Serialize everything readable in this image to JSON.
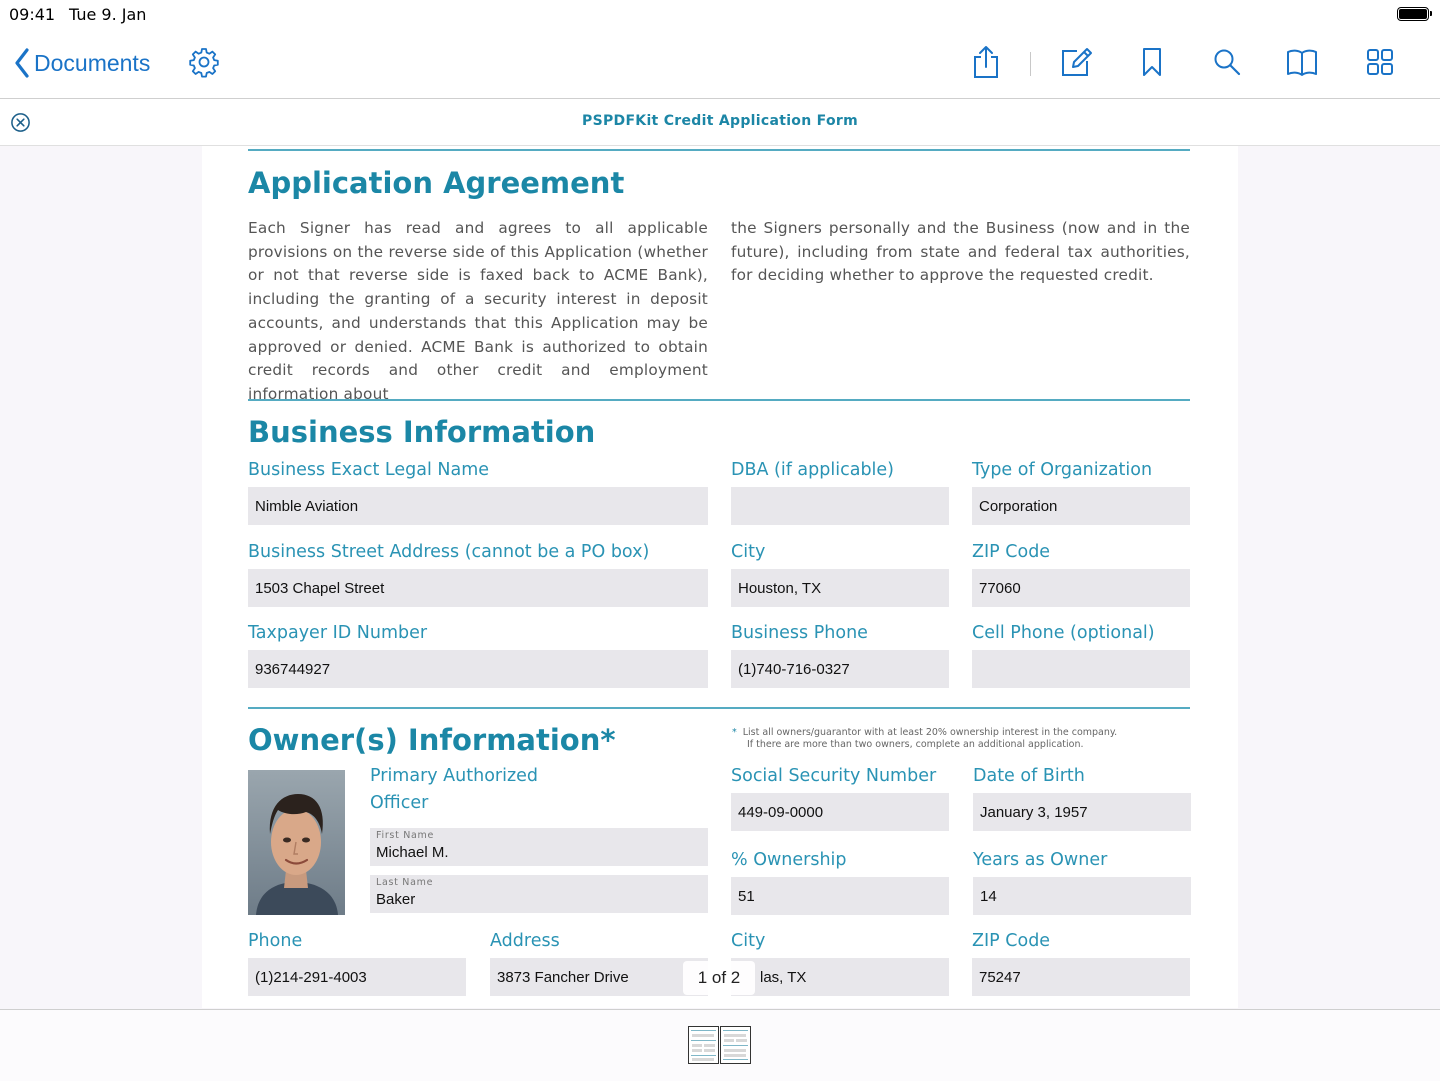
{
  "status": {
    "time": "09:41",
    "date": "Tue 9. Jan"
  },
  "nav": {
    "back_label": "Documents",
    "icons": [
      "gear-icon",
      "share-icon",
      "annotate-icon",
      "bookmark-icon",
      "search-icon",
      "outline-icon",
      "thumbnail-grid-icon"
    ]
  },
  "document": {
    "title": "PSPDFKit Credit Application Form"
  },
  "agreement": {
    "heading": "Application Agreement",
    "col1": "Each Signer has read and agrees to all applicable provisions on the reverse side of this Application (whether or not that reverse side is faxed back to ACME Bank), including the granting of a security interest in deposit accounts, and understands that this Application may be approved or denied. ACME Bank is authorized to obtain credit records and other credit and employment information about",
    "col2": "the Signers personally and the Business (now and in the future), including from state and federal tax authorities, for deciding whether to approve the requested credit."
  },
  "business": {
    "heading": "Business Information",
    "legal_name_label": "Business Exact Legal Name",
    "legal_name": "Nimble Aviation",
    "dba_label": "DBA (if applicable)",
    "dba": "",
    "org_type_label": "Type of Organization",
    "org_type": "Corporation",
    "street_label": "Business Street Address (cannot be a PO box)",
    "street": "1503 Chapel Street",
    "city_label": "City",
    "city": "Houston, TX",
    "zip_label": "ZIP Code",
    "zip": "77060",
    "taxpayer_label": "Taxpayer ID Number",
    "taxpayer": "936744927",
    "phone_label": "Business Phone",
    "phone": "(1)740-716-0327",
    "cell_label": "Cell Phone (optional)",
    "cell": ""
  },
  "owner": {
    "heading": "Owner(s) Information*",
    "note_line1": "List all owners/guarantor with at least 20% ownership interest in the company.",
    "note_line2": "If there are more than two owners, complete an additional application.",
    "officer_label_line1": "Primary Authorized",
    "officer_label_line2": "Officer",
    "first_name_label": "First Name",
    "first_name": "Michael M.",
    "last_name_label": "Last Name",
    "last_name": "Baker",
    "ssn_label": "Social Security Number",
    "ssn": "449-09-0000",
    "dob_label": "Date of Birth",
    "dob": "January 3, 1957",
    "ownership_label": "% Ownership",
    "ownership": "51",
    "years_label": "Years as Owner",
    "years": "14",
    "phone_label": "Phone",
    "phone": "(1)214-291-4003",
    "address_label": "Address",
    "address": "3873 Fancher Drive",
    "city_label": "City",
    "city": "las, TX",
    "zip_label": "ZIP Code",
    "zip": "75247"
  },
  "pager": {
    "indicator": "1 of 2"
  },
  "colors": {
    "accent": "#1b87a6",
    "link": "#1a73c7",
    "field": "#e8e7eb"
  }
}
